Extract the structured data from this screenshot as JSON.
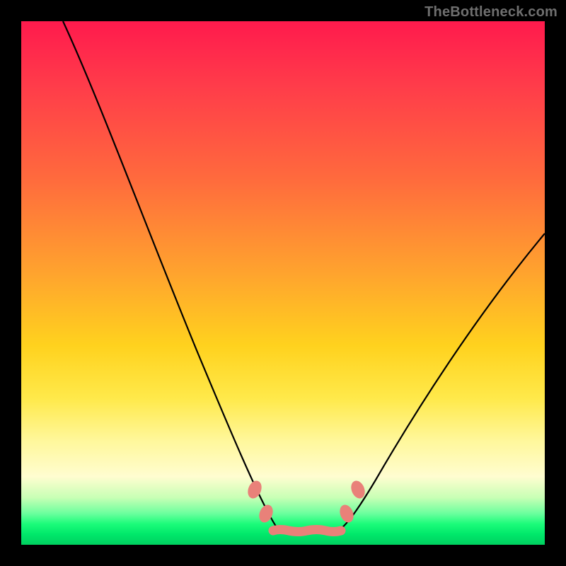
{
  "attribution": "TheBottleneck.com",
  "chart_data": {
    "type": "line",
    "title": "",
    "xlabel": "",
    "ylabel": "",
    "xlim": [
      0,
      100
    ],
    "ylim": [
      0,
      100
    ],
    "series": [
      {
        "name": "left-curve",
        "x": [
          8,
          12,
          16,
          20,
          24,
          28,
          32,
          36,
          40,
          42,
          44,
          46,
          47,
          48
        ],
        "y": [
          100,
          88,
          75,
          62,
          50,
          39,
          29,
          20,
          12,
          9,
          6.5,
          4.5,
          3.5,
          3
        ]
      },
      {
        "name": "right-curve",
        "x": [
          60,
          61,
          63,
          66,
          70,
          75,
          80,
          85,
          90,
          95,
          100
        ],
        "y": [
          3,
          3.5,
          5,
          8,
          13,
          20,
          28,
          36,
          44,
          52,
          60
        ]
      },
      {
        "name": "valley-floor",
        "x": [
          48,
          50,
          52,
          54,
          56,
          58,
          60
        ],
        "y": [
          3,
          2.6,
          2.5,
          2.5,
          2.5,
          2.7,
          3
        ]
      }
    ],
    "markers": [
      {
        "name": "left-wall-marker-upper",
        "x": 44.5,
        "y": 10.5
      },
      {
        "name": "left-wall-marker-lower",
        "x": 46.5,
        "y": 6.0
      },
      {
        "name": "right-wall-marker-lower",
        "x": 61.5,
        "y": 6.0
      },
      {
        "name": "right-wall-marker-upper",
        "x": 63.5,
        "y": 10.5
      }
    ],
    "gradient_stops": [
      {
        "pos": 0.0,
        "color": "#ff1a4d"
      },
      {
        "pos": 0.48,
        "color": "#ffa32e"
      },
      {
        "pos": 0.8,
        "color": "#fff79a"
      },
      {
        "pos": 0.96,
        "color": "#1cfc7a"
      },
      {
        "pos": 1.0,
        "color": "#00d060"
      }
    ]
  }
}
